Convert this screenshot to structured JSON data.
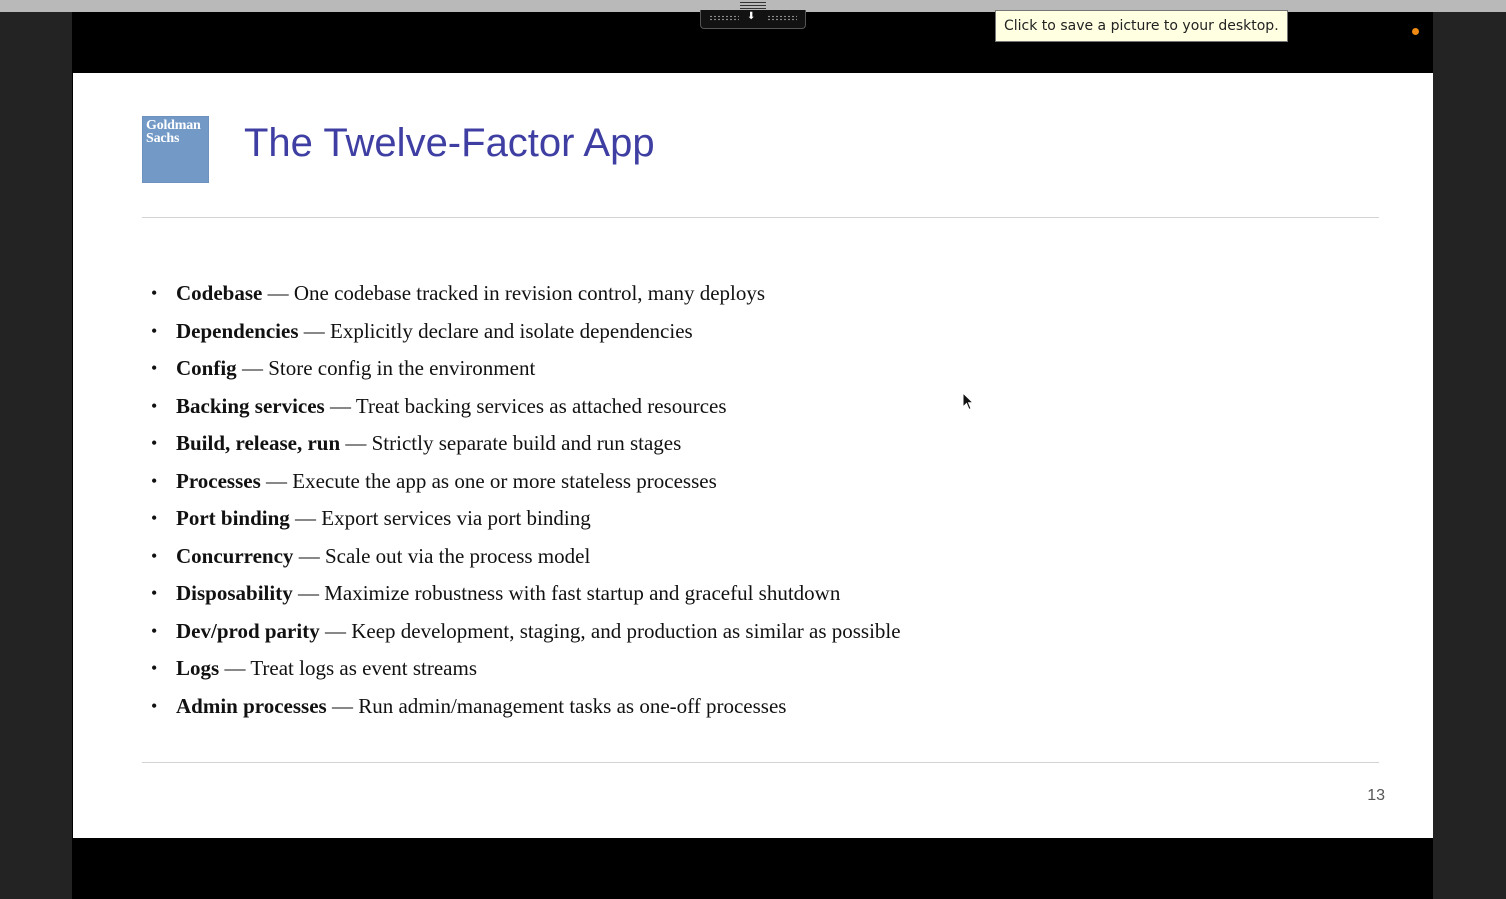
{
  "tooltip": {
    "text": "Click to save a picture to your desktop."
  },
  "slide": {
    "logo_line1": "Goldman",
    "logo_line2": "Sachs",
    "title": "The Twelve-Factor App",
    "page_number": "13",
    "factors": [
      {
        "name": "Codebase",
        "separator": " — ",
        "description": "One codebase tracked in revision control, many deploys"
      },
      {
        "name": "Dependencies",
        "separator": " — ",
        "description": "Explicitly declare and isolate dependencies"
      },
      {
        "name": "Config",
        "separator": " — ",
        "description": "Store config in the environment"
      },
      {
        "name": "Backing services",
        "separator": " — ",
        "description": "Treat backing services as attached resources"
      },
      {
        "name": "Build, release, run",
        "separator": " — ",
        "description": "Strictly separate build and run stages"
      },
      {
        "name": "Processes",
        "separator": " — ",
        "description": "Execute the app as one or more stateless processes"
      },
      {
        "name": "Port binding",
        "separator": " — ",
        "description": "Export services via port binding"
      },
      {
        "name": "Concurrency",
        "separator": " — ",
        "description": "Scale out via the process model"
      },
      {
        "name": "Disposability",
        "separator": " — ",
        "description": "Maximize robustness with fast startup and graceful shutdown"
      },
      {
        "name": "Dev/prod parity",
        "separator": " — ",
        "description": "Keep development, staging, and production as similar as possible"
      },
      {
        "name": "Logs",
        "separator": " — ",
        "description": "Treat logs as event streams"
      },
      {
        "name": "Admin processes",
        "separator": " — ",
        "description": "Run admin/management tasks as one-off processes"
      }
    ]
  },
  "colors": {
    "title": "#3f3fa3",
    "logo_bg": "#7399c6",
    "tooltip_bg": "#ffffe1",
    "status_dot": "#f08a12"
  },
  "icons": {
    "bullet": "•",
    "handle_arrow": "⬇"
  }
}
